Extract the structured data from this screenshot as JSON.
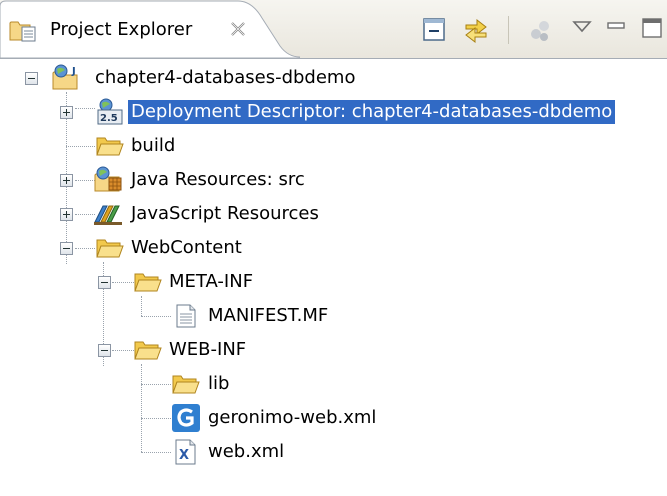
{
  "view": {
    "title": "Project Explorer",
    "toolbar": [
      "collapse-all-icon",
      "link-with-editor-icon",
      "filter-icon",
      "view-menu-icon",
      "minimize-icon",
      "maximize-icon"
    ]
  },
  "colors": {
    "selection": "#316ac5",
    "header_bg": "#ece9d8"
  },
  "tree": {
    "project": "chapter4-databases-dbdemo",
    "deployment_descriptor": "Deployment Descriptor: chapter4-databases-dbdemo",
    "deployment_badge": "2.5",
    "build": "build",
    "java_resources": "Java Resources: src",
    "javascript_resources": "JavaScript Resources",
    "webcontent": "WebContent",
    "meta_inf": "META-INF",
    "manifest": "MANIFEST.MF",
    "web_inf": "WEB-INF",
    "lib": "lib",
    "geronimo": "geronimo-web.xml",
    "webxml": "web.xml",
    "webxml_badge": "X"
  }
}
